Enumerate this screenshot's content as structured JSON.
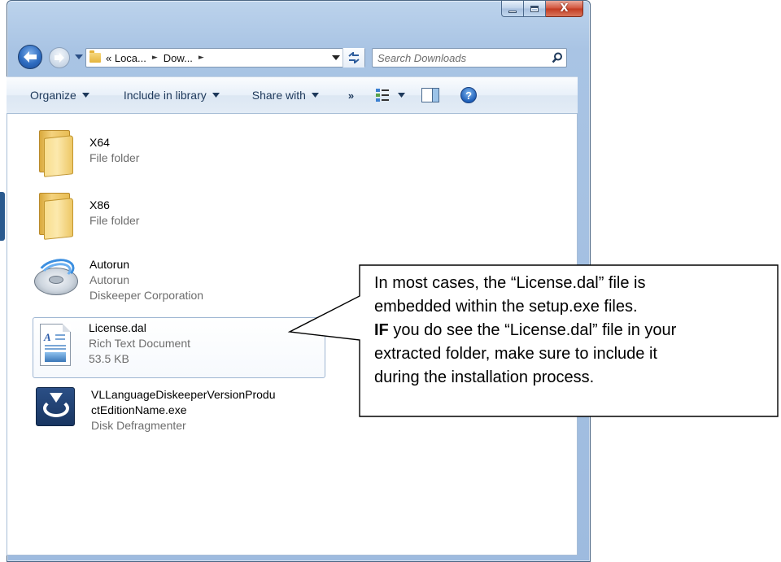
{
  "window": {
    "caption": {
      "minimize": "–",
      "maximize": "□",
      "close": "X"
    }
  },
  "address": {
    "crumbs": [
      "« Loca...",
      "Dow..."
    ],
    "separator": "►"
  },
  "search": {
    "placeholder": "Search Downloads"
  },
  "toolbar": {
    "organize": "Organize",
    "include": "Include in library",
    "share": "Share with",
    "more": "»",
    "help": "?"
  },
  "files": [
    {
      "name": "X64",
      "type": "File folder",
      "icon": "folder-icon"
    },
    {
      "name": "X86",
      "type": "File folder",
      "icon": "folder-icon"
    },
    {
      "name": "Autorun",
      "type": "Autorun",
      "company": "Diskeeper Corporation",
      "icon": "autorun-disc-icon"
    },
    {
      "name": "License.dal",
      "type": "Rich Text Document",
      "size": "53.5 KB",
      "icon": "rich-text-document-icon",
      "selected": true
    },
    {
      "name_line1": "VLLanguageDiskeeperVersionProdu",
      "name_line2": "ctEditionName.exe",
      "type": "Disk Defragmenter",
      "icon": "disk-defragmenter-icon"
    }
  ],
  "callout": {
    "line1": "In most cases, the “License.dal” file is",
    "line2": "embedded within the setup.exe files.",
    "line3_bold": "IF",
    "line3_rest": " you do see the “License.dal” file in your",
    "line4": "extracted folder, make sure to include it",
    "line5": "during the installation process."
  },
  "colors": {
    "frame": "#a9c4e4",
    "close_button": "#c23b22",
    "command_text": "#1e395b",
    "selection_border": "#9fb6d2"
  }
}
